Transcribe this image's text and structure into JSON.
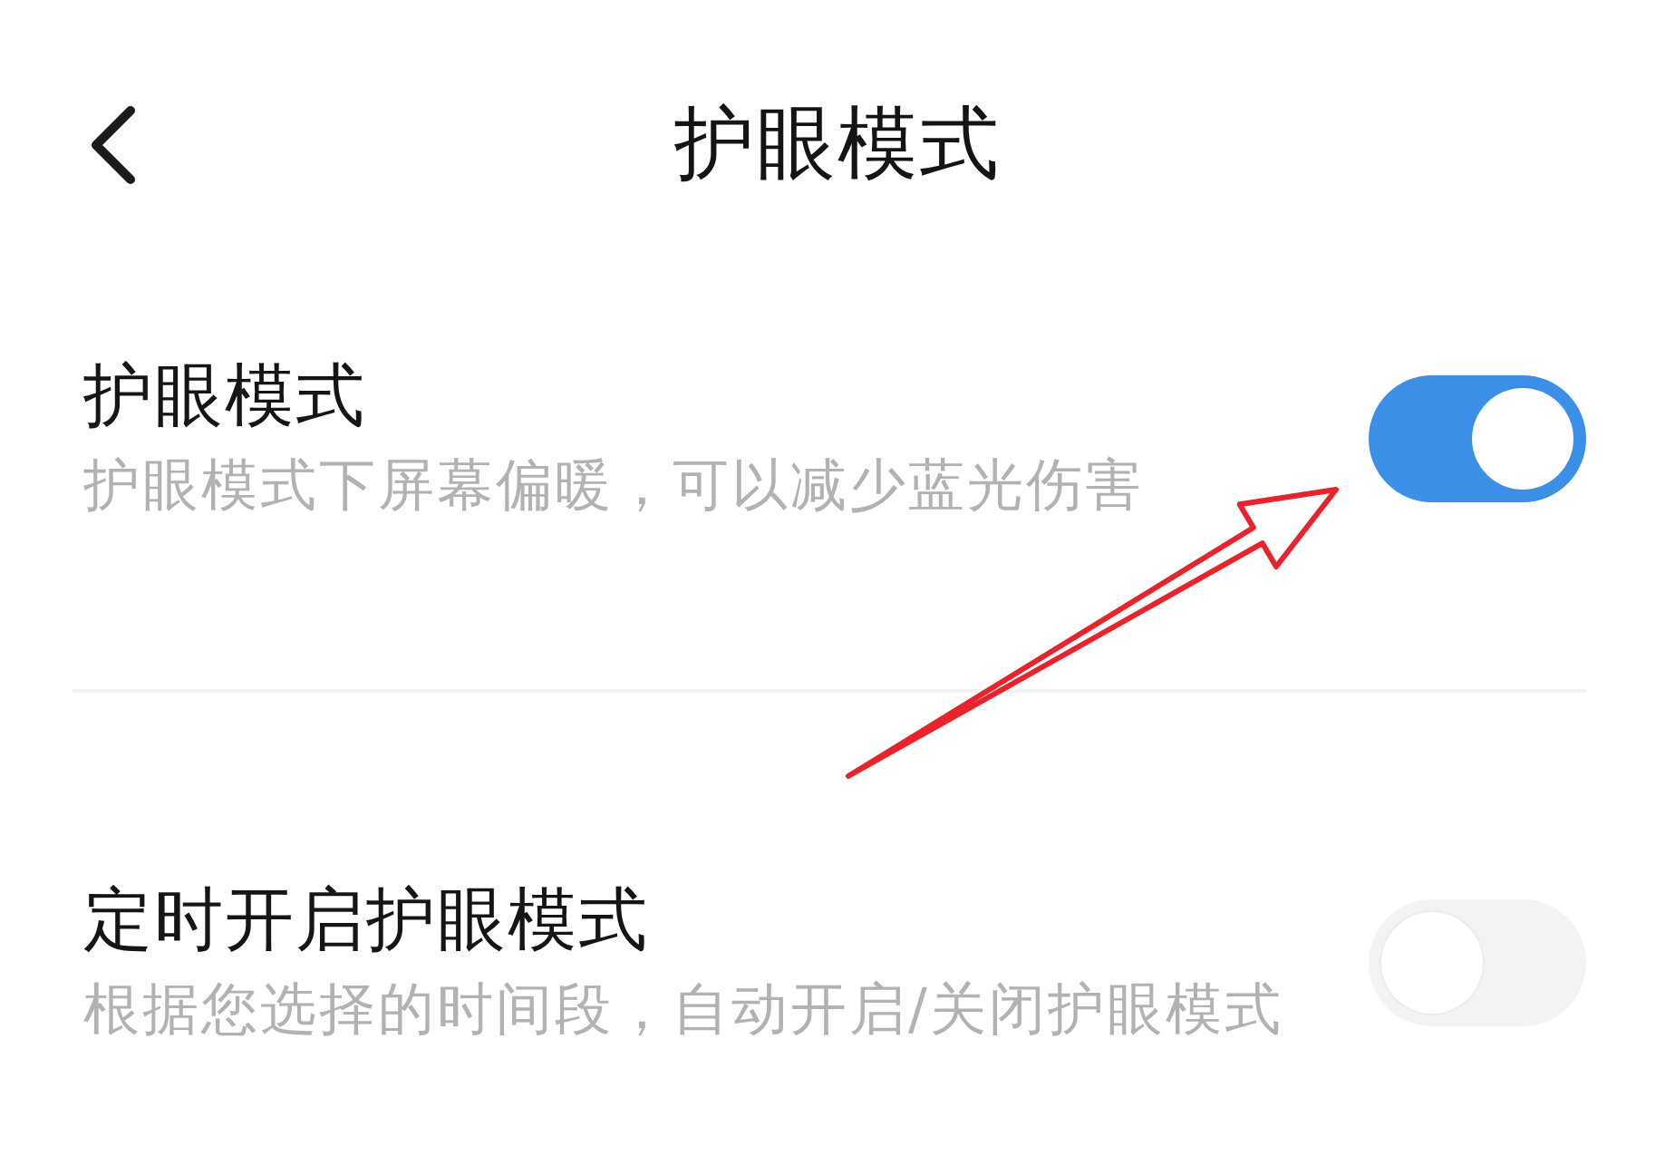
{
  "header": {
    "title": "护眼模式"
  },
  "settings": [
    {
      "title": "护眼模式",
      "description": "护眼模式下屏幕偏暖，可以减少蓝光伤害",
      "on": true
    },
    {
      "title": "定时开启护眼模式",
      "description": "根据您选择的时间段，自动开启/关闭护眼模式",
      "on": false
    }
  ],
  "annotations": [
    {
      "kind": "arrow"
    }
  ]
}
